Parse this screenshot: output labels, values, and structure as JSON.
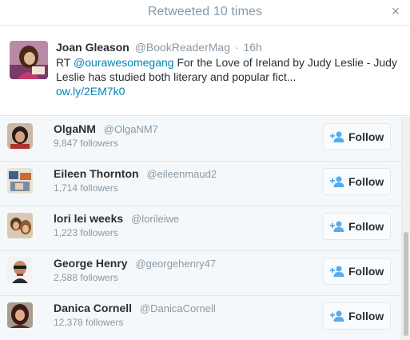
{
  "modal": {
    "title": "Retweeted 10 times",
    "close_label": "×"
  },
  "tweet": {
    "name": "Joan Gleason",
    "handle": "@BookReaderMag",
    "dot": "·",
    "time": "16h",
    "text_prefix": "RT ",
    "mention": "@ourawesomegang",
    "text_rest": " For the Love of Ireland by Judy Leslie - Judy Leslie has studied both literary and popular fict...",
    "link": "ow.ly/2EM7k0"
  },
  "users": [
    {
      "name": "OlgaNM",
      "handle": "@OlgaNM7",
      "followers": "9,847 followers",
      "follow_label": "Follow"
    },
    {
      "name": "Eileen Thornton",
      "handle": "@eileenmaud2",
      "followers": "1,714 followers",
      "follow_label": "Follow"
    },
    {
      "name": "lori lei weeks",
      "handle": "@lorileiwe",
      "followers": "1,223 followers",
      "follow_label": "Follow"
    },
    {
      "name": "George Henry",
      "handle": "@georgehenry47",
      "followers": "2,588 followers",
      "follow_label": "Follow"
    },
    {
      "name": "Danica Cornell",
      "handle": "@DanicaCornell",
      "followers": "12,378 followers",
      "follow_label": "Follow"
    }
  ],
  "colors": {
    "link": "#0084b4",
    "muted": "#8899a6",
    "list_bg": "#f5f8fa"
  },
  "icons": {
    "close": "close-icon",
    "follow": "add-user-icon"
  }
}
